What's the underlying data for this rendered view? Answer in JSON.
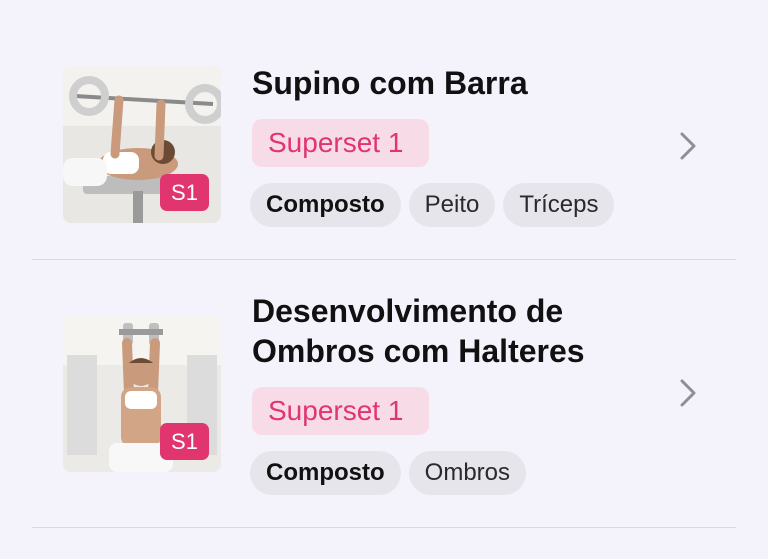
{
  "exercises": [
    {
      "title": "Supino com Barra",
      "thumb_badge": "S1",
      "superset_label": "Superset  1",
      "tags": [
        "Composto",
        "Peito",
        "Tríceps"
      ]
    },
    {
      "title": "Desenvolvimento de Ombros com Halteres",
      "thumb_badge": "S1",
      "superset_label": "Superset  1",
      "tags": [
        "Composto",
        "Ombros"
      ]
    }
  ],
  "colors": {
    "background": "#f4f2fb",
    "accent": "#e0356f",
    "superset_bg": "#f7dce8",
    "chip_bg": "#e6e5ec"
  },
  "icons": {
    "row_chevron": "chevron-right-icon"
  }
}
